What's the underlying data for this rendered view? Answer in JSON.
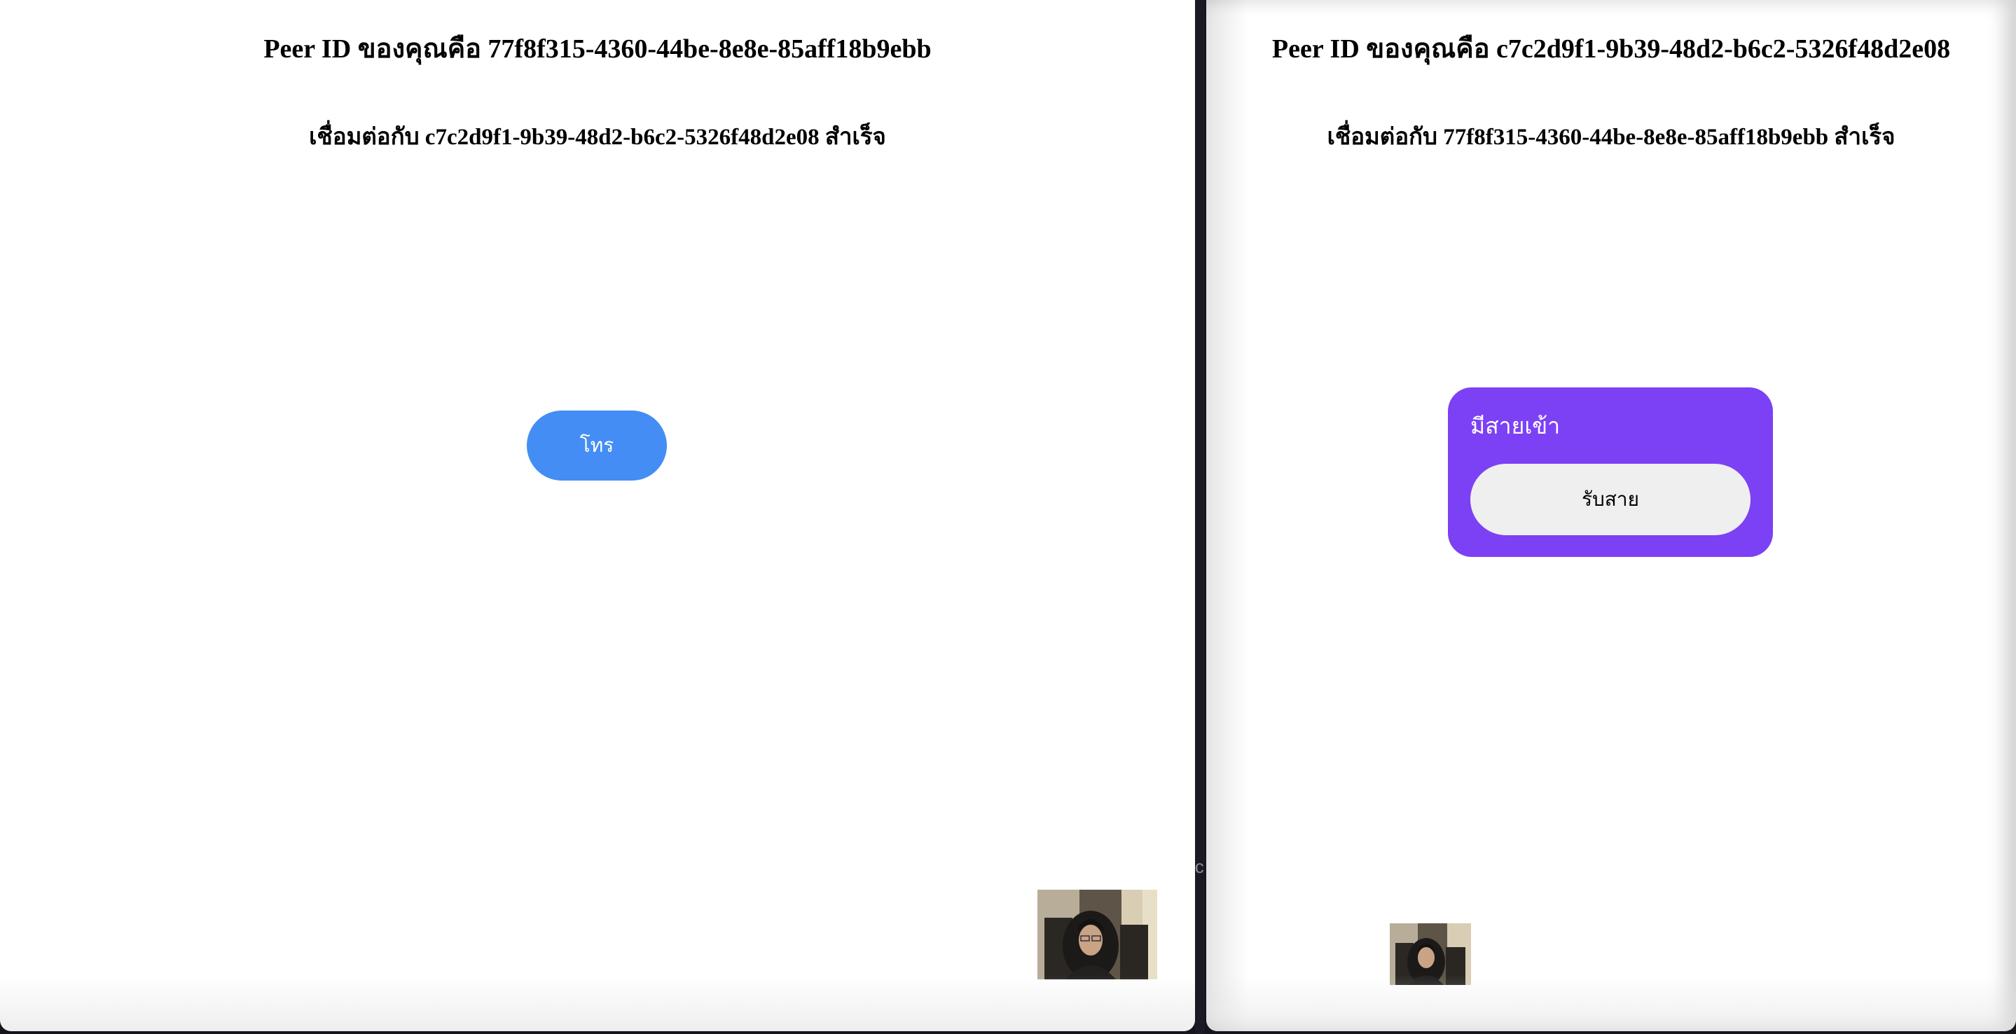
{
  "left_window": {
    "peer_title": "Peer ID ของคุณคือ 77f8f315-4360-44be-8e8e-85aff18b9ebb",
    "status": "เชื่อมต่อกับ c7c2d9f1-9b39-48d2-b6c2-5326f48d2e08 สำเร็จ",
    "call_button_label": "โทร",
    "local_video_icon": "webcam-self-view"
  },
  "right_window": {
    "peer_title": "Peer ID ของคุณคือ c7c2d9f1-9b39-48d2-b6c2-5326f48d2e08",
    "status": "เชื่อมต่อกับ 77f8f315-4360-44be-8e8e-85aff18b9ebb สำเร็จ",
    "incoming_call_label": "มีสายเข้า",
    "answer_button_label": "รับสาย",
    "local_video_icon": "webcam-self-view"
  },
  "colors": {
    "call_button": "#438df4",
    "incoming_panel": "#7c41f5",
    "answer_button": "#efefef"
  }
}
